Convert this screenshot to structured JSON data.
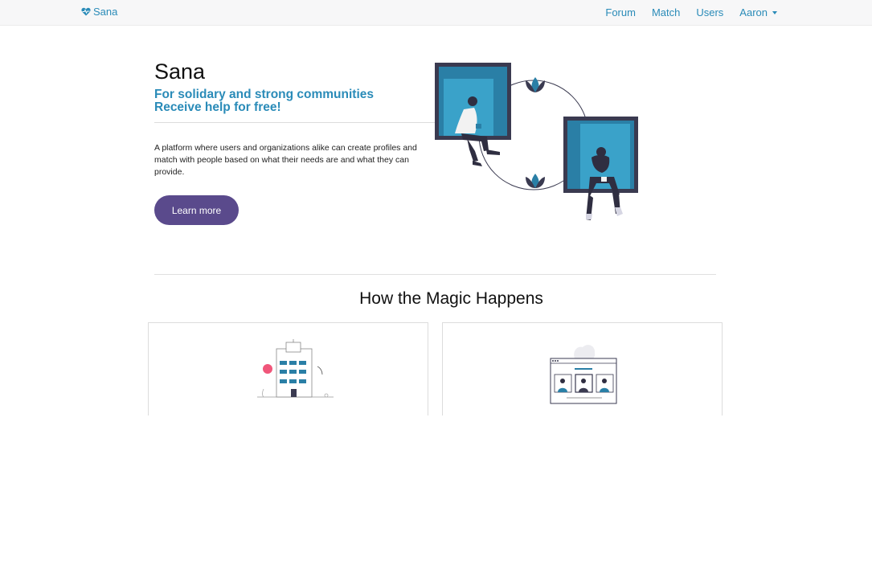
{
  "nav": {
    "brand": "Sana",
    "links": [
      "Forum",
      "Match",
      "Users"
    ],
    "user": "Aaron"
  },
  "hero": {
    "title": "Sana",
    "tagline_line1": "For solidary and strong communities",
    "tagline_line2": "Receive help for free!",
    "description": "A platform where users and organizations alike can create profiles and match with people based on what their needs are and what they can provide.",
    "button": "Learn more"
  },
  "section": {
    "title": "How the Magic Happens"
  },
  "colors": {
    "accent": "#2a8bb8",
    "button": "#5a4a8c",
    "frame": "#3a3a50"
  },
  "icons": {
    "brand": "heart-pulse-icon",
    "card1": "building-illustration",
    "card2": "video-call-illustration"
  }
}
